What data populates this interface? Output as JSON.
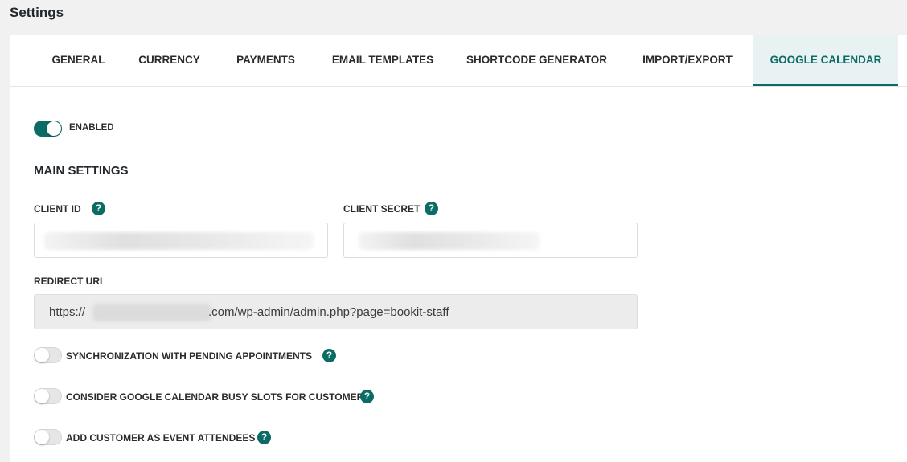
{
  "page": {
    "title": "Settings"
  },
  "tabs": [
    {
      "label": "GENERAL",
      "active": false
    },
    {
      "label": "CURRENCY",
      "active": false
    },
    {
      "label": "PAYMENTS",
      "active": false
    },
    {
      "label": "EMAIL TEMPLATES",
      "active": false
    },
    {
      "label": "SHORTCODE GENERATOR",
      "active": false
    },
    {
      "label": "IMPORT/EXPORT",
      "active": false
    },
    {
      "label": "GOOGLE CALENDAR",
      "active": true
    }
  ],
  "enabled_toggle": {
    "label": "ENABLED",
    "on": true
  },
  "main_settings": {
    "title": "MAIN SETTINGS",
    "client_id": {
      "label": "CLIENT ID",
      "help": "?"
    },
    "client_secret": {
      "label": "CLIENT SECRET",
      "help": "?"
    },
    "redirect_uri": {
      "label": "REDIRECT URI",
      "value_prefix": "https://",
      "value_suffix": ".com/wp-admin/admin.php?page=bookit-staff"
    }
  },
  "options": [
    {
      "label": "SYNCHRONIZATION WITH PENDING APPOINTMENTS",
      "on": false,
      "help": "?"
    },
    {
      "label": "CONSIDER GOOGLE CALENDAR BUSY SLOTS FOR CUSTOMERS",
      "on": false,
      "help": "?"
    },
    {
      "label": "ADD CUSTOMER AS EVENT ATTENDEES",
      "on": false,
      "help": "?"
    }
  ],
  "colors": {
    "accent": "#0b6b65",
    "active_tab_bg": "#e8f2f2",
    "background": "#f1f1f1"
  },
  "icons": {
    "help": "question-mark-icon"
  }
}
